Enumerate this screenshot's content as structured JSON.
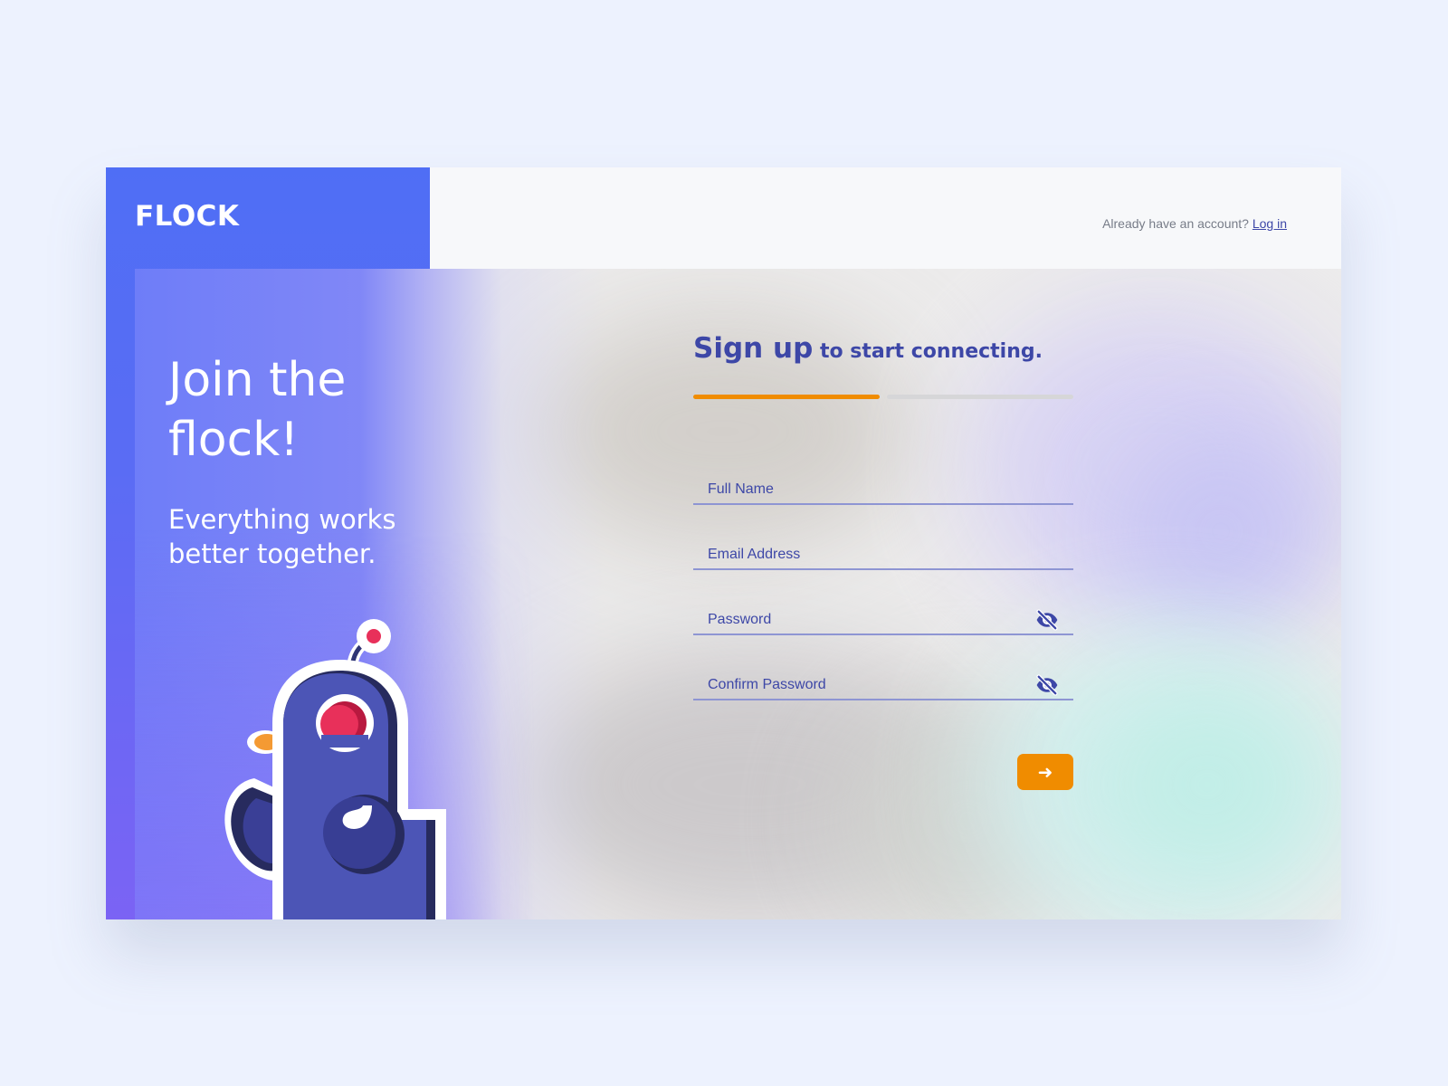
{
  "brand": {
    "logo": "FLOCK"
  },
  "topbar": {
    "login_prompt": "Already have an account?",
    "login_link": "Log in"
  },
  "hero": {
    "title": "Join the flock!",
    "subtitle": "Everything works better together."
  },
  "signup": {
    "heading_strong": "Sign up",
    "heading_rest": "to start connecting.",
    "progress": {
      "current_step": 1,
      "total_steps": 2
    },
    "fields": [
      {
        "label": "Full Name"
      },
      {
        "label": "Email Address"
      },
      {
        "label": "Password",
        "icon": "eye-off-icon"
      },
      {
        "label": "Confirm Password",
        "icon": "eye-off-icon"
      }
    ],
    "submit_icon": "arrow-right-icon",
    "submit_glyph": "➜"
  },
  "colors": {
    "page_background": "#edf2fe",
    "brand_blue": "#4f6ef5",
    "accent_orange": "#f08c00",
    "text_indigo": "#3d47a7",
    "progress_inactive": "#d6d6d8"
  }
}
